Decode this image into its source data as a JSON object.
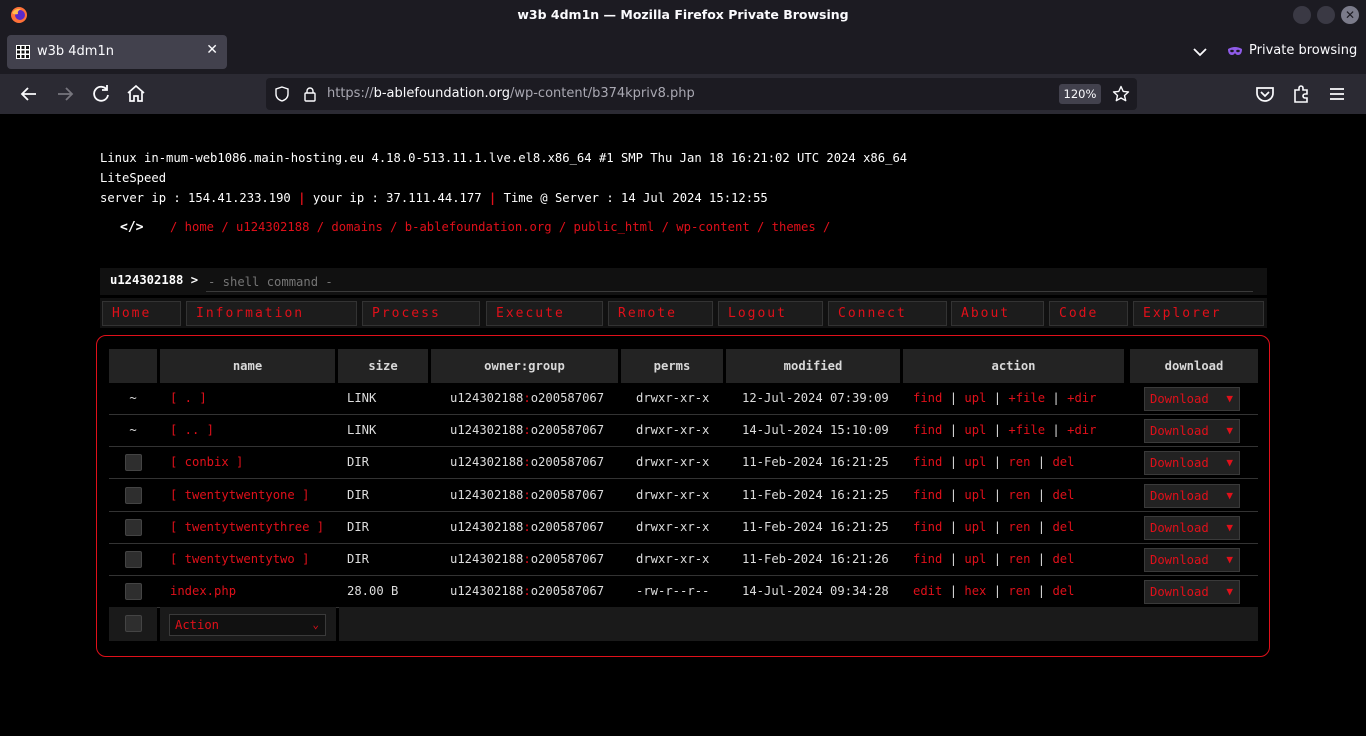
{
  "window": {
    "title": "w3b 4dm1n — Mozilla Firefox Private Browsing"
  },
  "tab": {
    "title": "w3b 4dm1n",
    "close": "✕"
  },
  "private_browsing": {
    "label": "Private browsing"
  },
  "urlbar": {
    "prefix": "https://",
    "host": "b-ablefoundation.org",
    "path": "/wp-content/b374kpriv8.php",
    "zoom": "120%"
  },
  "sysinfo": {
    "uname": "Linux in-mum-web1086.main-hosting.eu 4.18.0-513.11.1.lve.el8.x86_64 #1 SMP Thu Jan 18 16:21:02 UTC 2024 x86_64",
    "software": "LiteSpeed",
    "server_ip": "server ip : 154.41.233.190",
    "your_ip": "your ip : 37.111.44.177",
    "time": "Time @ Server : 14 Jul 2024 15:12:55",
    "separator": "|"
  },
  "breadcrumb": {
    "icon": "</>",
    "path": "/ home / u124302188 / domains / b-ablefoundation.org / public_html / wp-content / themes /"
  },
  "shell": {
    "user": "u124302188 >",
    "placeholder": "- shell command -"
  },
  "menu": [
    "Home",
    "Information",
    "Process",
    "Execute",
    "Remote",
    "Logout",
    "Connect",
    "About",
    "Code",
    "Explorer"
  ],
  "table": {
    "headers": [
      "name",
      "size",
      "owner:group",
      "perms",
      "modified",
      "action",
      "download"
    ],
    "rows": [
      {
        "sel": "~",
        "name": "[ . ]",
        "size": "LINK",
        "owner": "u124302188",
        "group": "o200587067",
        "perms": "drwxr-xr-x",
        "modified": "12-Jul-2024 07:39:09",
        "actions": [
          "find",
          "upl",
          "+file",
          "+dir"
        ],
        "download": "Download"
      },
      {
        "sel": "~",
        "name": "[ .. ]",
        "size": "LINK",
        "owner": "u124302188",
        "group": "o200587067",
        "perms": "drwxr-xr-x",
        "modified": "14-Jul-2024 15:10:09",
        "actions": [
          "find",
          "upl",
          "+file",
          "+dir"
        ],
        "download": "Download"
      },
      {
        "sel": "",
        "name": "[ conbix ]",
        "size": "DIR",
        "owner": "u124302188",
        "group": "o200587067",
        "perms": "drwxr-xr-x",
        "modified": "11-Feb-2024 16:21:25",
        "actions": [
          "find",
          "upl",
          "ren",
          "del"
        ],
        "download": "Download"
      },
      {
        "sel": "",
        "name": "[ twentytwentyone ]",
        "size": "DIR",
        "owner": "u124302188",
        "group": "o200587067",
        "perms": "drwxr-xr-x",
        "modified": "11-Feb-2024 16:21:25",
        "actions": [
          "find",
          "upl",
          "ren",
          "del"
        ],
        "download": "Download"
      },
      {
        "sel": "",
        "name": "[ twentytwentythree ]",
        "size": "DIR",
        "owner": "u124302188",
        "group": "o200587067",
        "perms": "drwxr-xr-x",
        "modified": "11-Feb-2024 16:21:25",
        "actions": [
          "find",
          "upl",
          "ren",
          "del"
        ],
        "download": "Download"
      },
      {
        "sel": "",
        "name": "[ twentytwentytwo ]",
        "size": "DIR",
        "owner": "u124302188",
        "group": "o200587067",
        "perms": "drwxr-xr-x",
        "modified": "11-Feb-2024 16:21:26",
        "actions": [
          "find",
          "upl",
          "ren",
          "del"
        ],
        "download": "Download"
      },
      {
        "sel": "",
        "name": "index.php",
        "size": "28.00 B",
        "owner": "u124302188",
        "group": "o200587067",
        "perms": "-rw-r--r--",
        "modified": "14-Jul-2024 09:34:28",
        "actions": [
          "edit",
          "hex",
          "ren",
          "del"
        ],
        "download": "Download"
      }
    ],
    "bulk_action": "Action"
  },
  "colors": {
    "accent": "#e0101a",
    "background": "#000000",
    "chrome_dark": "#1c1b22",
    "chrome_mid": "#2b2a33"
  },
  "icons": [
    "firefox-logo-icon",
    "grid-favicon-icon",
    "back-arrow-icon",
    "forward-arrow-icon",
    "reload-icon",
    "home-icon",
    "shield-icon",
    "lock-icon",
    "bookmark-star-icon",
    "pocket-icon",
    "extensions-icon",
    "hamburger-menu-icon",
    "private-mask-icon",
    "chevron-down-icon"
  ]
}
